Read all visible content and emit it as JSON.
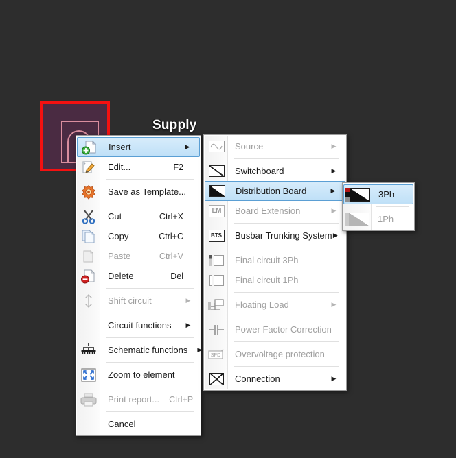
{
  "canvas": {
    "background_color": "#2d2d2d",
    "selection": {
      "label": "Supply",
      "border_color": "#f41111",
      "fill_color": "#4a2b42",
      "symbol_color": "#d98e9e"
    }
  },
  "context_menu": {
    "name": "element-context-menu",
    "highlight_color": "#bfe0f7",
    "highlight_border_color": "#5b9fd4",
    "items": [
      {
        "label": "Insert",
        "accel": "",
        "icon": "insert-icon",
        "arrow": true,
        "disabled": false,
        "selected": true,
        "sep_after": false
      },
      {
        "label": "Edit...",
        "accel": "F2",
        "icon": "edit-icon",
        "arrow": false,
        "disabled": false,
        "selected": false,
        "sep_after": true
      },
      {
        "label": "Save as Template...",
        "accel": "",
        "icon": "gear-icon",
        "arrow": false,
        "disabled": false,
        "selected": false,
        "sep_after": true
      },
      {
        "label": "Cut",
        "accel": "Ctrl+X",
        "icon": "scissors-icon",
        "arrow": false,
        "disabled": false,
        "selected": false,
        "sep_after": false
      },
      {
        "label": "Copy",
        "accel": "Ctrl+C",
        "icon": "copy-icon",
        "arrow": false,
        "disabled": false,
        "selected": false,
        "sep_after": false
      },
      {
        "label": "Paste",
        "accel": "Ctrl+V",
        "icon": "paste-icon",
        "arrow": false,
        "disabled": true,
        "selected": false,
        "sep_after": false
      },
      {
        "label": "Delete",
        "accel": "Del",
        "icon": "delete-icon",
        "arrow": false,
        "disabled": false,
        "selected": false,
        "sep_after": true
      },
      {
        "label": "Shift circuit",
        "accel": "",
        "icon": "updown-arrow-icon",
        "arrow": true,
        "disabled": true,
        "selected": false,
        "sep_after": true
      },
      {
        "label": "Circuit functions",
        "accel": "",
        "icon": "blank-icon",
        "arrow": true,
        "disabled": false,
        "selected": false,
        "sep_after": true
      },
      {
        "label": "Schematic functions",
        "accel": "",
        "icon": "schematic-icon",
        "arrow": true,
        "disabled": false,
        "selected": false,
        "sep_after": true
      },
      {
        "label": "Zoom to element",
        "accel": "",
        "icon": "zoom-icon",
        "arrow": false,
        "disabled": false,
        "selected": false,
        "sep_after": true
      },
      {
        "label": "Print report...",
        "accel": "Ctrl+P",
        "icon": "printer-icon",
        "arrow": false,
        "disabled": true,
        "selected": false,
        "sep_after": true
      },
      {
        "label": "Cancel",
        "accel": "",
        "icon": "blank-icon",
        "arrow": false,
        "disabled": false,
        "selected": false,
        "sep_after": false
      }
    ]
  },
  "insert_submenu": {
    "name": "insert-submenu",
    "items": [
      {
        "label": "Source",
        "icon": "source-icon",
        "arrow": true,
        "disabled": true,
        "selected": false,
        "sep_after": true
      },
      {
        "label": "Switchboard",
        "icon": "switchboard-icon",
        "arrow": true,
        "disabled": false,
        "selected": false,
        "sep_after": false
      },
      {
        "label": "Distribution Board",
        "icon": "distribution-board-icon",
        "arrow": true,
        "disabled": false,
        "selected": true,
        "sep_after": false
      },
      {
        "label": "Board Extension",
        "icon": "board-extension-icon",
        "arrow": true,
        "disabled": true,
        "selected": false,
        "sep_after": true
      },
      {
        "label": "Busbar Trunking System",
        "icon": "bts-icon",
        "arrow": true,
        "disabled": false,
        "selected": false,
        "sep_after": true
      },
      {
        "label": "Final circuit 3Ph",
        "icon": "final-circuit-3ph-icon",
        "arrow": false,
        "disabled": true,
        "selected": false,
        "sep_after": false
      },
      {
        "label": "Final circuit 1Ph",
        "icon": "final-circuit-1ph-icon",
        "arrow": false,
        "disabled": true,
        "selected": false,
        "sep_after": true
      },
      {
        "label": "Floating Load",
        "icon": "floating-load-icon",
        "arrow": true,
        "disabled": true,
        "selected": false,
        "sep_after": true
      },
      {
        "label": "Power Factor Correction",
        "icon": "power-factor-icon",
        "arrow": false,
        "disabled": true,
        "selected": false,
        "sep_after": true
      },
      {
        "label": "Overvoltage protection",
        "icon": "spd-icon",
        "arrow": false,
        "disabled": true,
        "selected": false,
        "sep_after": true
      },
      {
        "label": "Connection",
        "icon": "connection-icon",
        "arrow": true,
        "disabled": false,
        "selected": false,
        "sep_after": false
      }
    ]
  },
  "phase_submenu": {
    "name": "distribution-board-phase-submenu",
    "items": [
      {
        "label": "3Ph",
        "icon": "board-3ph-icon",
        "disabled": false,
        "selected": true,
        "sep_after": true
      },
      {
        "label": "1Ph",
        "icon": "board-1ph-icon",
        "disabled": true,
        "selected": false,
        "sep_after": false
      }
    ]
  }
}
